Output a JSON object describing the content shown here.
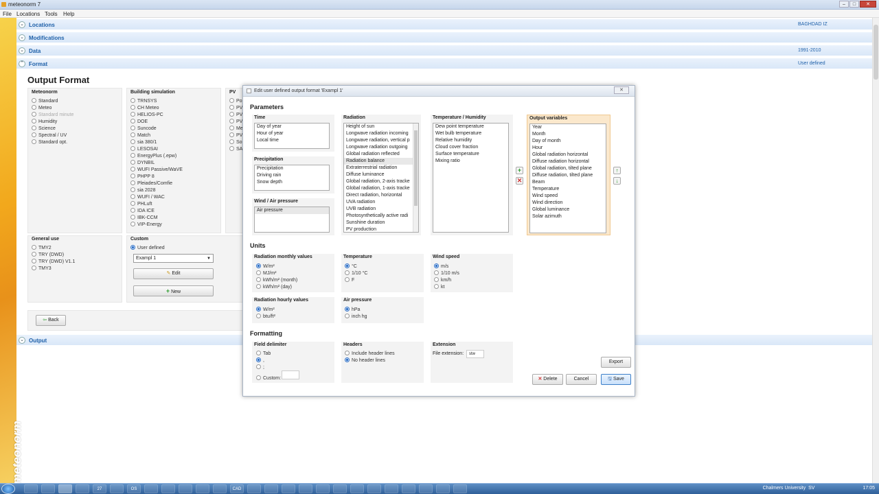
{
  "window": {
    "title": "meteonorm 7",
    "brand": "meteonorm"
  },
  "menu": [
    "File",
    "Locations",
    "Tools",
    "Help"
  ],
  "sections": {
    "locations": {
      "label": "Locations",
      "value": "BAGHDAD IZ"
    },
    "modifications": {
      "label": "Modifications",
      "value": ""
    },
    "data": {
      "label": "Data",
      "value": "1991-2010"
    },
    "format": {
      "label": "Format",
      "value": "User defined"
    },
    "output": {
      "label": "Output",
      "value": ""
    }
  },
  "page_title": "Output Format",
  "meteonorm_group": {
    "label": "Meteonorm",
    "options": [
      {
        "label": "Standard",
        "state": "off"
      },
      {
        "label": "Meteo",
        "state": "off"
      },
      {
        "label": "Standard minute",
        "state": "disabled"
      },
      {
        "label": "Humidity",
        "state": "off"
      },
      {
        "label": "Science",
        "state": "off"
      },
      {
        "label": "Spectral / UV",
        "state": "off"
      },
      {
        "label": "Standard opt.",
        "state": "off"
      }
    ]
  },
  "building_group": {
    "label": "Building simulation",
    "options": [
      "TRNSYS",
      "CH Meteo",
      "HELIOS-PC",
      "DOE",
      "Suncode",
      "Match",
      "sia 380/1",
      "LESOSAI",
      "EnergyPlus (.epw)",
      "DYNBIL",
      "WUFI Passive/WaVE",
      "PHPP 8",
      "Pleiades/Comfie",
      "sia 2028",
      "WUFI / WAC",
      "PHLuft",
      "IDA ICE",
      "IBK-CCM",
      "VIP-Energy"
    ]
  },
  "pv_group": {
    "label": "PV",
    "options": [
      "Po",
      "PV",
      "PV",
      "PV",
      "Me",
      "PV",
      "So",
      "SA"
    ]
  },
  "general_group": {
    "label": "General use",
    "options": [
      "TMY2",
      "TRY (DWD)",
      "TRY (DWD) V1.1",
      "TMY3"
    ]
  },
  "custom_group": {
    "label": "Custom",
    "option": "User defined",
    "selected_format": "Exampl 1",
    "edit_label": "Edit",
    "new_label": "New"
  },
  "back_label": "Back",
  "dialog": {
    "title": "Edit user defined output format 'Exampl 1'",
    "parameters_heading": "Parameters",
    "time": {
      "label": "Time",
      "items": [
        "Day of year",
        "Hour of year",
        "Local time"
      ]
    },
    "precipitation": {
      "label": "Precipitation",
      "items": [
        "Precipitation",
        "Driving rain",
        "Snow depth"
      ]
    },
    "wind": {
      "label": "Wind / Air pressure",
      "items": [
        "Air pressure"
      ]
    },
    "radiation": {
      "label": "Radiation",
      "items": [
        "Height of sun",
        "Longwave radiation incoming",
        "Longwave radiation, vertical p",
        "Longwave radiation outgoing",
        "Global radiation reflected",
        "Radiation balance",
        "Extraterrestrial radiation",
        "Diffuse luminance",
        "Global radiation, 2-axis tracke",
        "Global radiation, 1-axis tracke",
        "Direct radiation, horizontal",
        "UVA radiation",
        "UVB radiation",
        "Photosynthetically active radi",
        "Sunshine duration",
        "PV production"
      ]
    },
    "temp_humidity": {
      "label": "Temperature / Humidity",
      "items": [
        "Dew point temperature",
        "Wet bulb temperature",
        "Relative humidity",
        "Cloud cover fraction",
        "Surface temperature",
        "Mixing ratio"
      ]
    },
    "output_vars": {
      "label": "Output variables",
      "items": [
        "Year",
        "Month",
        "Day of month",
        "Hour",
        "Global radiation horizontal",
        "Diffuse radiation horizontal",
        "Global radiation, tilted plane",
        "Diffuse radiation, tilted plane",
        "Beam",
        "Temperature",
        "Wind speed",
        "Wind direction",
        "Global luminance",
        "Solar azimuth"
      ]
    },
    "units_heading": "Units",
    "rad_monthly": {
      "label": "Radiation monthly values",
      "options": [
        "W/m²",
        "MJ/m²",
        "kWh/m² (month)",
        "kWh/m² (day)"
      ],
      "selected": 0
    },
    "temperature": {
      "label": "Temperature",
      "options": [
        "°C",
        "1/10 °C",
        "F"
      ],
      "selected": 0
    },
    "wind_speed": {
      "label": "Wind speed",
      "options": [
        "m/s",
        "1/10 m/s",
        "km/h",
        "kt"
      ],
      "selected": 0
    },
    "rad_hourly": {
      "label": "Radiation hourly values",
      "options": [
        "W/m²",
        "btu/ft²"
      ],
      "selected": 0
    },
    "air_pressure": {
      "label": "Air pressure",
      "options": [
        "hPa",
        "inch hg"
      ],
      "selected": 0
    },
    "formatting_heading": "Formatting",
    "field_delim": {
      "label": "Field delimiter",
      "options": [
        "Tab",
        ",",
        ";",
        "Custom:"
      ],
      "selected": 1
    },
    "headers": {
      "label": "Headers",
      "options": [
        "Include header lines",
        "No header lines"
      ],
      "selected": 1
    },
    "extension": {
      "label": "Extension",
      "field_label": "File extension:",
      "value": "stw"
    },
    "export_label": "Export",
    "delete_label": "Delete",
    "cancel_label": "Cancel",
    "save_label": "Save"
  },
  "taskbar": {
    "items": [
      "",
      "",
      "",
      "",
      "27",
      "",
      "OS",
      "",
      "",
      "",
      "",
      "",
      "CAD",
      "",
      "",
      "",
      "",
      "",
      "",
      "",
      "",
      "",
      "",
      "",
      "",
      ""
    ],
    "tray_text": "Chalmers University",
    "lang": "SV",
    "clock": "17:05"
  }
}
